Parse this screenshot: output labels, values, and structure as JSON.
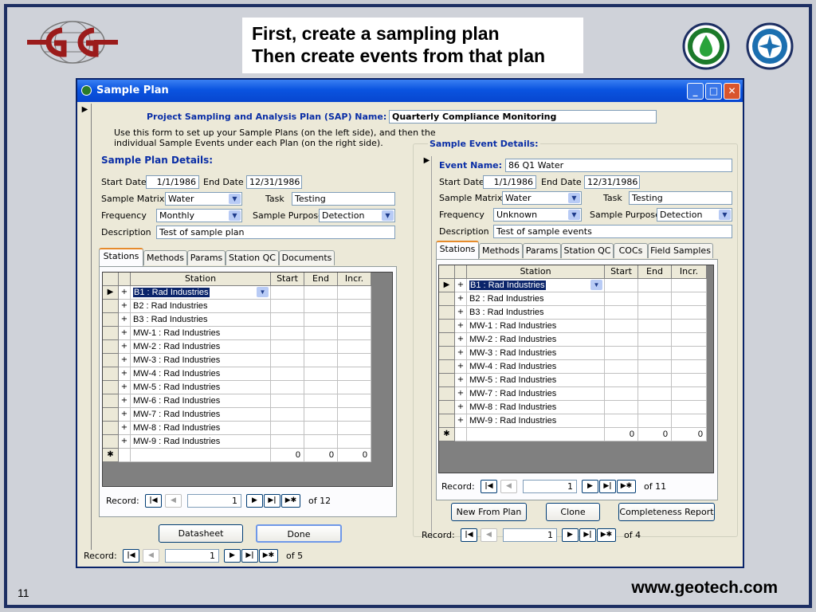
{
  "slide": {
    "caption_line1": "First, create a sampling plan",
    "caption_line2": "Then create events from that plan",
    "url": "www.geotech.com",
    "number": "11"
  },
  "window": {
    "title": "Sample Plan",
    "minimize_icon": "minimize-icon",
    "maximize_icon": "maximize-icon",
    "close_icon": "close-icon"
  },
  "plan": {
    "sap_label": "Project Sampling and Analysis Plan (SAP) Name:",
    "sap_value": "Quarterly Compliance Monitoring",
    "instructions_line1": "Use this form to set up your Sample Plans (on the left side), and then the",
    "instructions_line2": "individual Sample Events under each Plan (on the right side).",
    "details_heading": "Sample Plan Details:",
    "start_date_label": "Start Date",
    "start_date": "1/1/1986",
    "end_date_label": "End Date",
    "end_date": "12/31/1986",
    "matrix_label": "Sample Matrix",
    "matrix": "Water",
    "task_label": "Task",
    "task": "Testing",
    "frequency_label": "Frequency",
    "frequency": "Monthly",
    "purpose_label": "Sample Purpose",
    "purpose": "Detection",
    "description_label": "Description",
    "description": "Test of sample plan",
    "tabs": [
      "Stations",
      "Methods",
      "Params",
      "Station QC",
      "Documents"
    ],
    "grid_headers": [
      "Station",
      "Start",
      "End",
      "Incr."
    ],
    "stations": [
      "B1 : Rad Industries",
      "B2 : Rad Industries",
      "B3 : Rad Industries",
      "MW-1 : Rad Industries",
      "MW-2 : Rad Industries",
      "MW-3 : Rad Industries",
      "MW-4 : Rad Industries",
      "MW-5 : Rad Industries",
      "MW-6 : Rad Industries",
      "MW-7 : Rad Industries",
      "MW-8 : Rad Industries",
      "MW-9 : Rad Industries"
    ],
    "new_row": {
      "start": "0",
      "end": "0",
      "incr": "0"
    },
    "grid_nav": {
      "label": "Record:",
      "current": "1",
      "of": "of  12"
    },
    "datasheet_button": "Datasheet",
    "done_button": "Done",
    "form_nav": {
      "label": "Record:",
      "current": "1",
      "of": "of  5"
    }
  },
  "event": {
    "group_heading": "Sample Event Details:",
    "name_label": "Event Name:",
    "name": "86 Q1 Water",
    "start_date_label": "Start Date",
    "start_date": "1/1/1986",
    "end_date_label": "End Date",
    "end_date": "12/31/1986",
    "matrix_label": "Sample Matrix",
    "matrix": "Water",
    "task_label": "Task",
    "task": "Testing",
    "frequency_label": "Frequency",
    "frequency": "Unknown",
    "purpose_label": "Sample Purpose",
    "purpose": "Detection",
    "description_label": "Description",
    "description": "Test of sample events",
    "tabs": [
      "Stations",
      "Methods",
      "Params",
      "Station QC",
      "COCs",
      "Field Samples"
    ],
    "grid_headers": [
      "Station",
      "Start",
      "End",
      "Incr."
    ],
    "stations": [
      "B1 : Rad Industries",
      "B2 : Rad Industries",
      "B3 : Rad Industries",
      "MW-1 : Rad Industries",
      "MW-2 : Rad Industries",
      "MW-3 : Rad Industries",
      "MW-4 : Rad Industries",
      "MW-5 : Rad Industries",
      "MW-7 : Rad Industries",
      "MW-8 : Rad Industries",
      "MW-9 : Rad Industries"
    ],
    "new_row": {
      "start": "0",
      "end": "0",
      "incr": "0"
    },
    "grid_nav": {
      "label": "Record:",
      "current": "1",
      "of": "of  11"
    },
    "new_from_plan_button": "New From Plan",
    "clone_button": "Clone",
    "completeness_button": "Completeness Report",
    "form_nav": {
      "label": "Record:",
      "current": "1",
      "of": "of  4"
    }
  },
  "glyphs": {
    "row_pointer": "▶",
    "expand": "+",
    "new_row": "✱",
    "first": "|◀",
    "prev": "◀",
    "next": "▶",
    "last": "▶|",
    "new": "▶✱",
    "dropdown": "▼"
  },
  "colors": {
    "heading_blue": "#0a2ea6",
    "title_bar": "#0a54e0",
    "slide_border": "#1d2f63",
    "logo_red": "#9b1b1b"
  }
}
